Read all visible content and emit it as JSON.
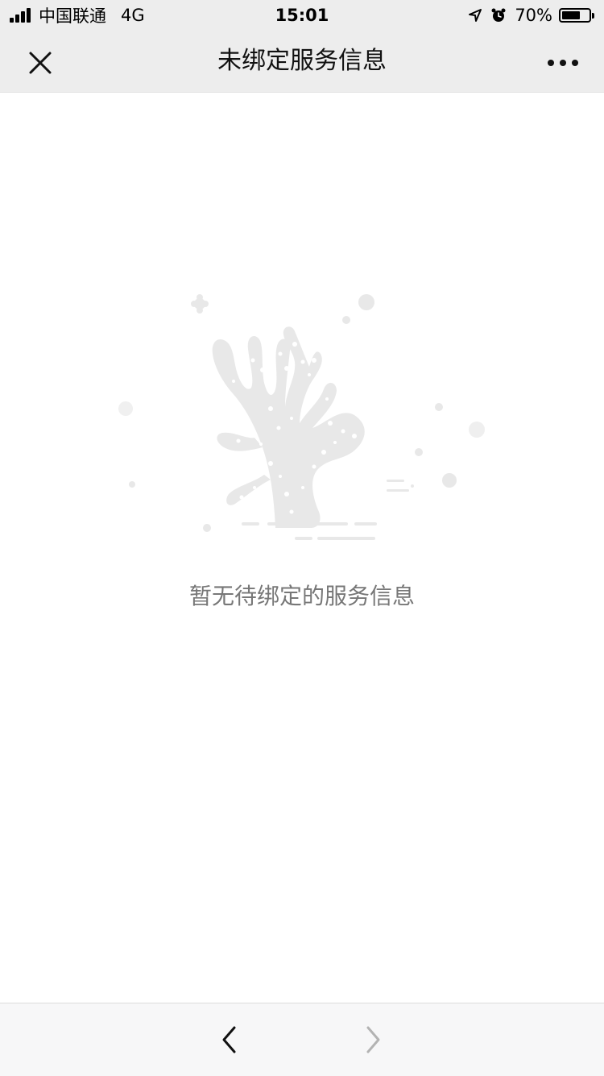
{
  "status_bar": {
    "carrier": "中国联通",
    "network": "4G",
    "time": "15:01",
    "battery_text": "70%",
    "battery_level": 0.7
  },
  "nav": {
    "title": "未绑定服务信息",
    "close_icon": "close-icon",
    "more_icon": "more-icon"
  },
  "empty_state": {
    "illustration": "coral-icon",
    "message": "暂无待绑定的服务信息"
  },
  "toolbar": {
    "back_icon": "chevron-left-icon",
    "forward_icon": "chevron-right-icon",
    "forward_enabled": false
  },
  "colors": {
    "header_bg": "#ededed",
    "illustration": "#e6e6e6",
    "message_text": "#777777",
    "toolbar_bg": "#f7f7f8",
    "disabled_icon": "#b3b3b3"
  }
}
